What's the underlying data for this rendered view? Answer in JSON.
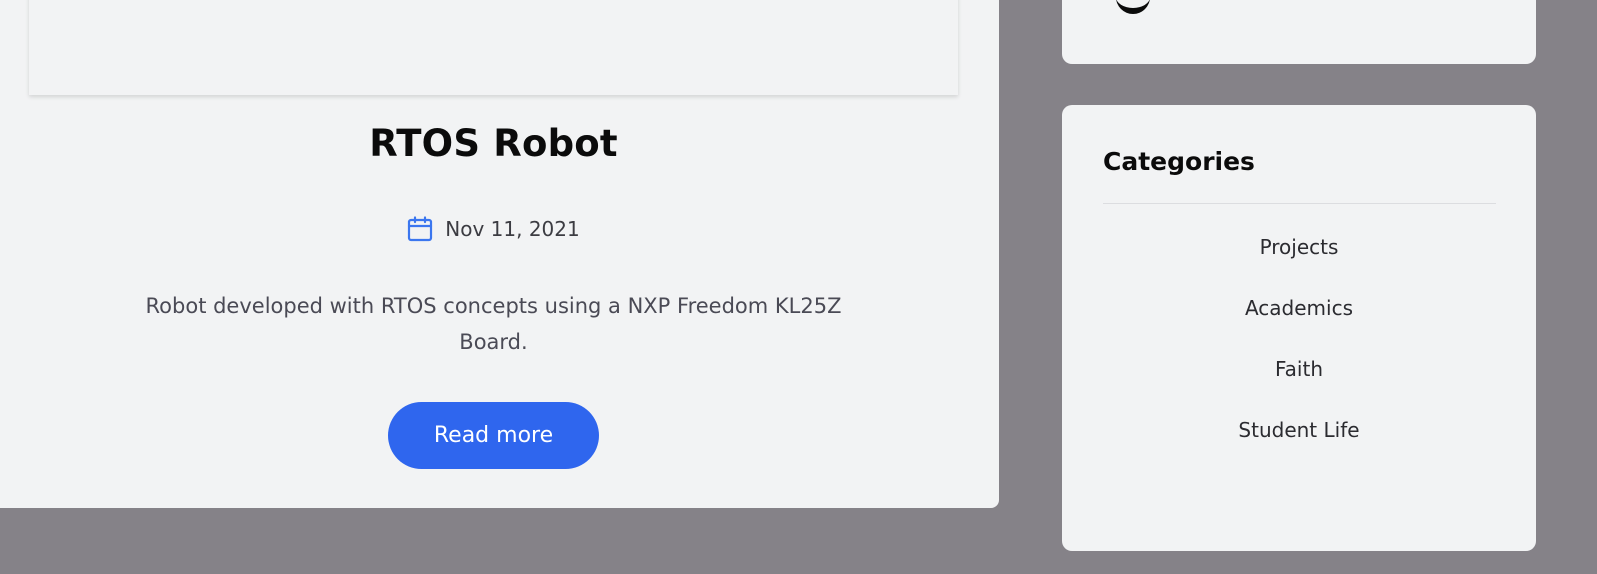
{
  "post": {
    "title": "RTOS Robot",
    "date": "Nov 11, 2021",
    "excerpt": "Robot developed with RTOS concepts using a NXP Freedom KL25Z Board.",
    "read_more_label": "Read more"
  },
  "sidebar": {
    "categories_title": "Categories",
    "categories": [
      "Projects",
      "Academics",
      "Faith",
      "Student Life"
    ]
  },
  "colors": {
    "page_background": "#858288",
    "card_background": "#f2f3f4",
    "accent": "#2f66ee",
    "calendar_icon": "#3b76ef"
  },
  "icons": {
    "date": "calendar-icon"
  }
}
